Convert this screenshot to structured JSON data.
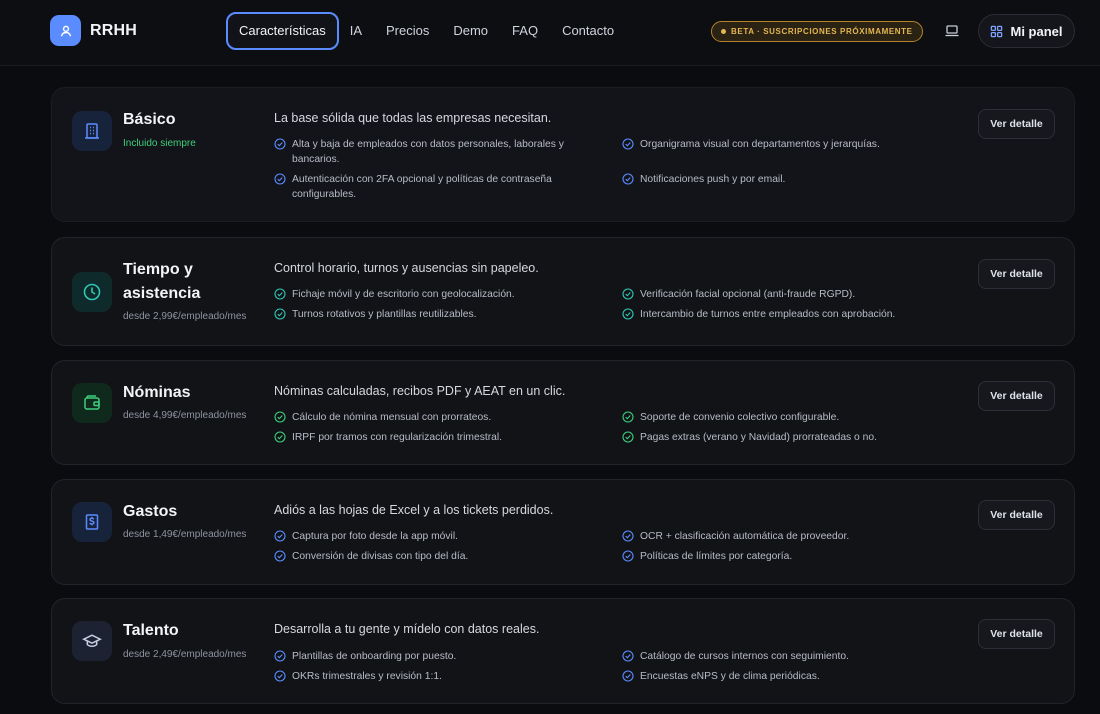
{
  "header": {
    "brand": "RRHH",
    "nav": [
      "Características",
      "IA",
      "Precios",
      "Demo",
      "FAQ",
      "Contacto"
    ],
    "beta_badge": "BETA · SUSCRIPCIONES PRÓXIMAMENTE",
    "panel_button": "Mi panel"
  },
  "colors": {
    "accent": "#5b8cff",
    "beta": "#e5b652",
    "green": "#3ccf7c"
  },
  "detail_label": "Ver detalle",
  "modules": [
    {
      "icon": "building-icon",
      "title": "Básico",
      "price": "Incluido siempre",
      "description": "La base sólida que todas las empresas necesitan.",
      "features": [
        "Alta y baja de empleados con datos personales, laborales y bancarios.",
        "Organigrama visual con departamentos y jerarquías.",
        "Autenticación con 2FA opcional y políticas de contraseña configurables.",
        "Notificaciones push y por email."
      ]
    },
    {
      "icon": "clock-icon",
      "title": "Tiempo y asistencia",
      "price": "desde 2,99€/empleado/mes",
      "description": "Control horario, turnos y ausencias sin papeleo.",
      "features": [
        "Fichaje móvil y de escritorio con geolocalización.",
        "Verificación facial opcional (anti-fraude RGPD).",
        "Turnos rotativos y plantillas reutilizables.",
        "Intercambio de turnos entre empleados con aprobación."
      ]
    },
    {
      "icon": "wallet-icon",
      "title": "Nóminas",
      "price": "desde 4,99€/empleado/mes",
      "description": "Nóminas calculadas, recibos PDF y AEAT en un clic.",
      "features": [
        "Cálculo de nómina mensual con prorrateos.",
        "Soporte de convenio colectivo configurable.",
        "IRPF por tramos con regularización trimestral.",
        "Pagas extras (verano y Navidad) prorrateadas o no."
      ]
    },
    {
      "icon": "receipt-dollar-icon",
      "title": "Gastos",
      "price": "desde 1,49€/empleado/mes",
      "description": "Adiós a las hojas de Excel y a los tickets perdidos.",
      "features": [
        "Captura por foto desde la app móvil.",
        "OCR + clasificación automática de proveedor.",
        "Conversión de divisas con tipo del día.",
        "Políticas de límites por categoría."
      ]
    },
    {
      "icon": "graduation-cap-icon",
      "title": "Talento",
      "price": "desde 2,49€/empleado/mes",
      "description": "Desarrolla a tu gente y mídelo con datos reales.",
      "features": [
        "Plantillas de onboarding por puesto.",
        "Catálogo de cursos internos con seguimiento.",
        "OKRs trimestrales y revisión 1:1.",
        "Encuestas eNPS y de clima periódicas."
      ]
    }
  ]
}
